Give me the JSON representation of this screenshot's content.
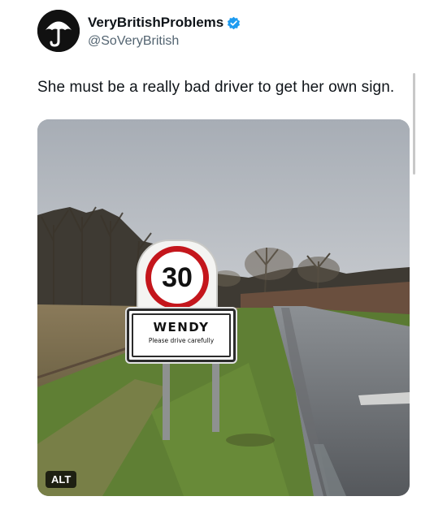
{
  "account": {
    "display_name": "VeryBritishProblems",
    "handle": "@SoVeryBritish",
    "verified": true,
    "avatar_icon": "umbrella-icon",
    "verified_color": "#1d9bf0"
  },
  "tweet": {
    "text": "She must be a really bad driver to get her own sign."
  },
  "media": {
    "alt_label": "ALT",
    "speed_limit": "30",
    "village_name": "WENDY",
    "village_note": "Please drive carefully"
  }
}
